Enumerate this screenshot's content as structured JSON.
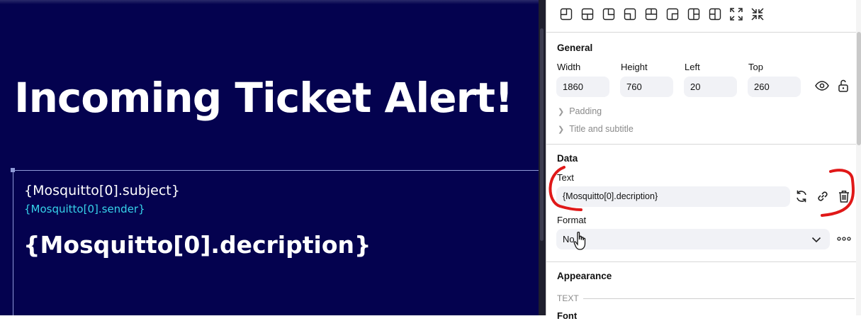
{
  "canvas": {
    "title": "Incoming Ticket Alert!",
    "subject": "{Mosquitto[0].subject}",
    "sender": "{Mosquitto[0].sender}",
    "description": "{Mosquitto[0].decription}",
    "background": "#04024f",
    "sender_color": "#36d3ea"
  },
  "toolbar": {
    "icons": [
      "layout-top-left-icon",
      "layout-top-center-icon",
      "layout-top-right-icon",
      "layout-bottom-left-icon",
      "layout-center-icon",
      "layout-bottom-right-icon",
      "layout-left-half-icon",
      "layout-right-half-icon",
      "expand-icon",
      "collapse-icon"
    ]
  },
  "general": {
    "title": "General",
    "width_label": "Width",
    "height_label": "Height",
    "left_label": "Left",
    "top_label": "Top",
    "width": "1860",
    "height": "760",
    "left": "20",
    "top": "260",
    "padding": "Padding",
    "title_subtitle": "Title and subtitle"
  },
  "data": {
    "title": "Data",
    "text_label": "Text",
    "text_value": "{Mosquitto[0].decription}",
    "format_label": "Format",
    "format_value": "No"
  },
  "appearance": {
    "title": "Appearance",
    "text_divider": "TEXT",
    "font_label": "Font"
  },
  "annotation_color": "#e01818"
}
